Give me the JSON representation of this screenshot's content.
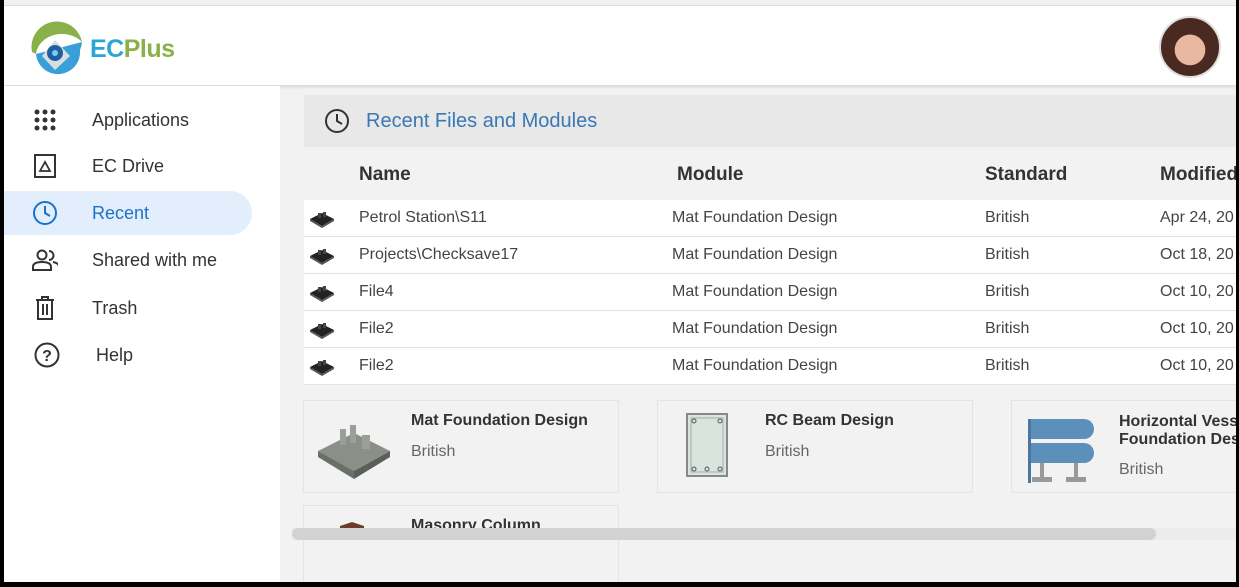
{
  "brand": {
    "name_part1": "EC",
    "name_part2": "Plus"
  },
  "sidebar": {
    "items": [
      {
        "label": "Applications",
        "icon": "grid-icon"
      },
      {
        "label": "EC Drive",
        "icon": "drive-icon"
      },
      {
        "label": "Recent",
        "icon": "clock-icon",
        "active": true
      },
      {
        "label": "Shared with me",
        "icon": "people-icon"
      },
      {
        "label": "Trash",
        "icon": "trash-icon"
      },
      {
        "label": "Help",
        "icon": "help-icon"
      }
    ]
  },
  "recent": {
    "title": "Recent Files and Modules",
    "columns": [
      "Name",
      "Module",
      "Standard",
      "Modified"
    ],
    "rows": [
      {
        "name": "Petrol Station\\S11",
        "module": "Mat Foundation Design",
        "standard": "British",
        "modified": "Apr 24, 20"
      },
      {
        "name": "Projects\\Checksave17",
        "module": "Mat Foundation Design",
        "standard": "British",
        "modified": "Oct 18, 20"
      },
      {
        "name": "File4",
        "module": "Mat Foundation Design",
        "standard": "British",
        "modified": "Oct 10, 20"
      },
      {
        "name": "File2",
        "module": "Mat Foundation Design",
        "standard": "British",
        "modified": "Oct 10, 20"
      },
      {
        "name": "File2",
        "module": "Mat Foundation Design",
        "standard": "British",
        "modified": "Oct 10, 20"
      }
    ]
  },
  "modules": [
    {
      "name": "Mat Foundation Design",
      "standard": "British"
    },
    {
      "name": "RC Beam Design",
      "standard": "British"
    },
    {
      "name": "Horizontal Vessel Foundation Design",
      "standard": "British"
    },
    {
      "name": "Masonry Column",
      "standard": ""
    }
  ],
  "colors": {
    "accent": "#1a73c8",
    "title": "#3a78b5",
    "active_bg": "#e3eefc"
  }
}
